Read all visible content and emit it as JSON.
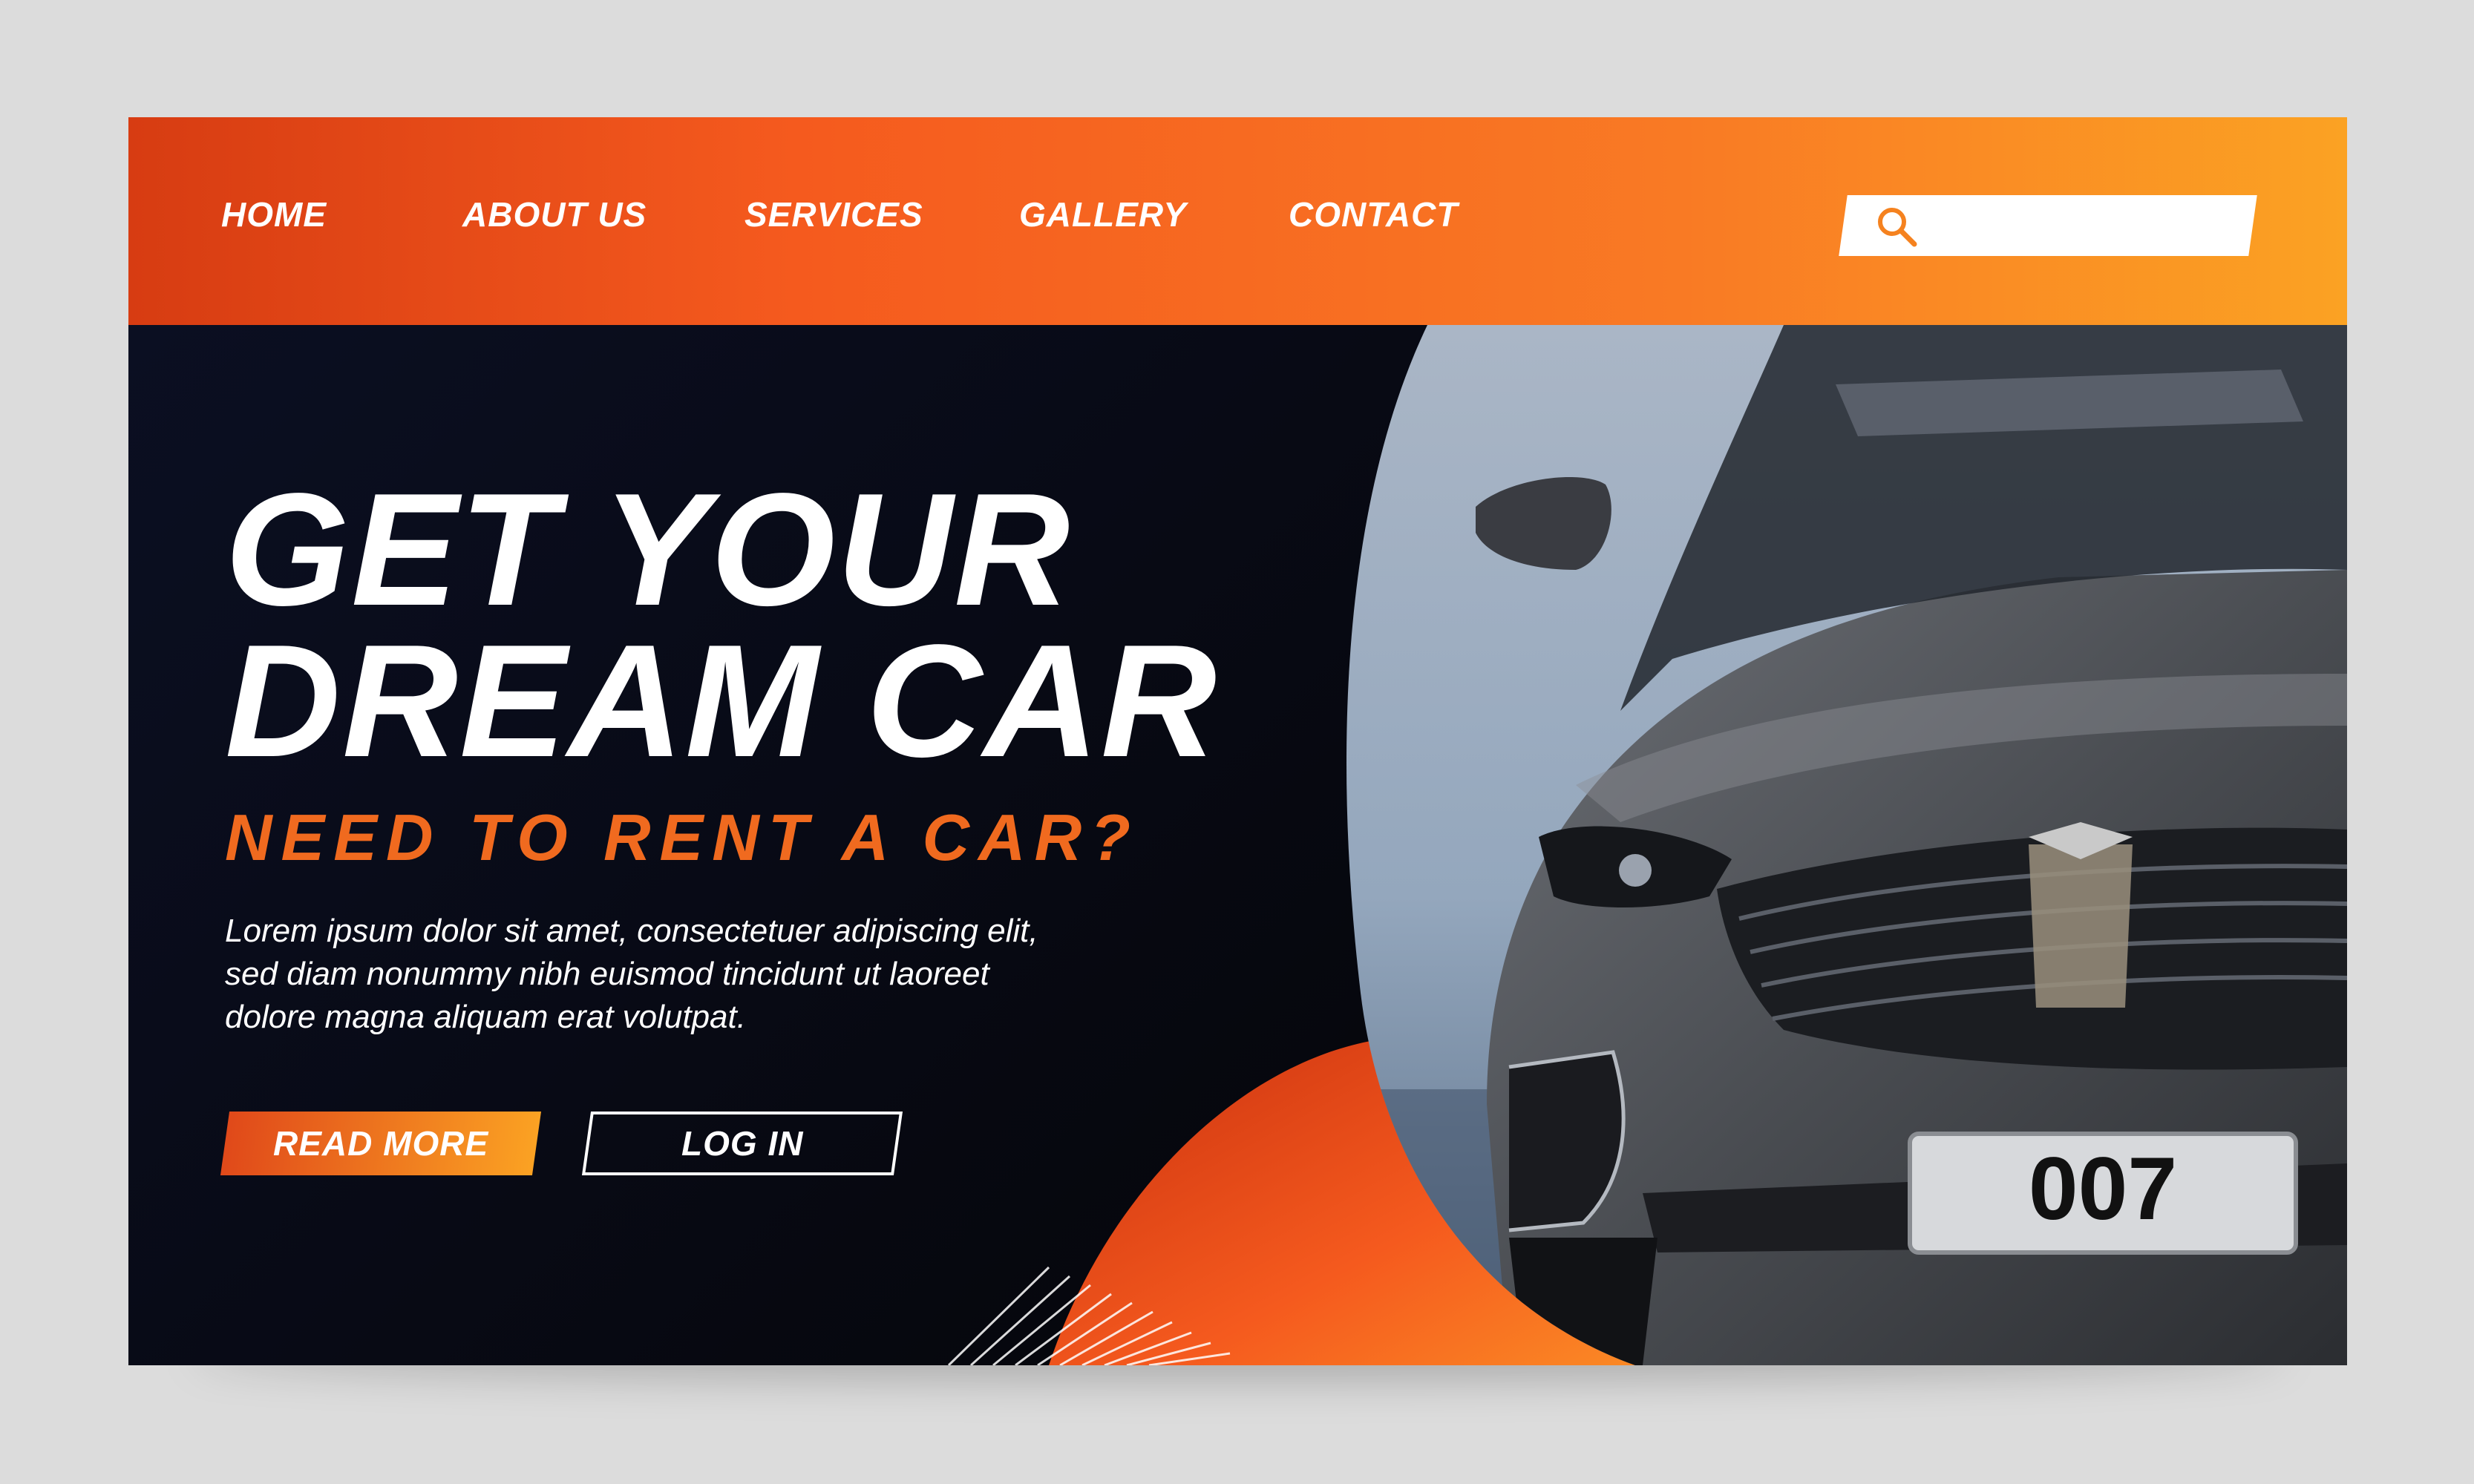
{
  "nav": {
    "items": [
      {
        "label": "HOME"
      },
      {
        "label": "ABOUT US"
      },
      {
        "label": "SERVICES"
      },
      {
        "label": "GALLERY"
      },
      {
        "label": "CONTACT"
      }
    ],
    "search": {
      "placeholder": "",
      "icon": "search-icon"
    }
  },
  "hero": {
    "headline_line1": "GET YOUR",
    "headline_line2": "DREAM CAR",
    "subheadline": "NEED TO RENT A CAR?",
    "body": "Lorem ipsum dolor sit amet, consectetuer adipiscing elit, sed diam nonummy nibh euismod tincidunt ut laoreet dolore magna aliquam erat volutpat.",
    "read_more_label": "READ MORE",
    "login_label": "LOG IN",
    "plate_number": "007"
  },
  "colors": {
    "accent_orange": "#f55a1e",
    "accent_amber": "#fba223",
    "dark_bg": "#0b0f22"
  }
}
